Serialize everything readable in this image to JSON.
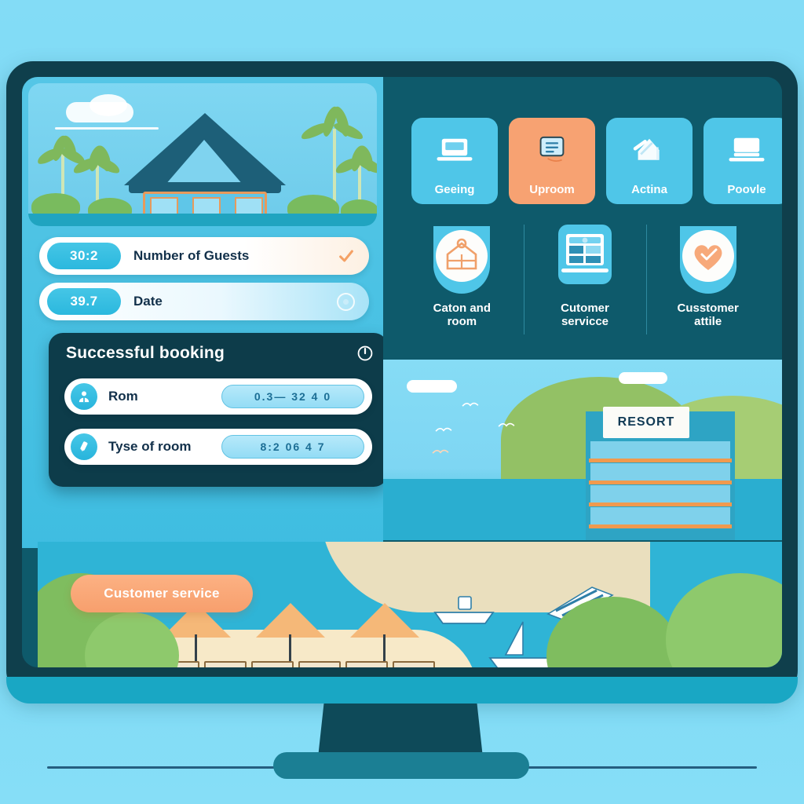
{
  "scene": {
    "device": "desktop-monitor",
    "background_color": "#7ddcf5",
    "bezel_color": "#0f3f4c",
    "screen_panel_color": "#0e5a6b"
  },
  "left_panel": {
    "hero_illustration": "tropical-resort-pavilion",
    "form_rows": [
      {
        "badge": "30:2",
        "label": "Number of Guests",
        "status_icon": "check-icon"
      },
      {
        "badge": "39.7",
        "label": "Date",
        "status_icon": "circle-icon"
      }
    ],
    "booking_card": {
      "title": "Successful booking",
      "header_icon": "power-icon",
      "rows": [
        {
          "icon": "person-icon",
          "label": "Rom",
          "value": "0.3— 32 4 0"
        },
        {
          "icon": "pen-icon",
          "label": "Tyse of room",
          "value": "8:2  06 4  7"
        }
      ]
    },
    "cta_button": {
      "label": "Customer service",
      "color": "#f79f6d"
    }
  },
  "right_panel": {
    "tiles": [
      {
        "label": "Geeing",
        "icon": "laptop-icon",
        "active": false
      },
      {
        "label": "Uproom",
        "icon": "document-screen-icon",
        "active": true
      },
      {
        "label": "Actina",
        "icon": "crane-icon",
        "active": false
      },
      {
        "label": "Poovle",
        "icon": "laptop-icon",
        "active": false
      }
    ],
    "features": [
      {
        "label_line1": "Caton and",
        "label_line2": "room",
        "icon": "building-badge-icon"
      },
      {
        "label_line1": "Cutomer",
        "label_line2": "servicce",
        "icon": "laptop-dashboard-icon"
      },
      {
        "label_line1": "Cusstomer",
        "label_line2": "attile",
        "icon": "heart-shield-icon"
      }
    ],
    "scenery": {
      "building_sign": "RESORT",
      "elements": [
        "sky",
        "clouds",
        "birds",
        "green-hills",
        "resort-building",
        "sea"
      ]
    }
  },
  "bottom_scene": {
    "elements": [
      "lagoon",
      "sand-beach",
      "beach-umbrellas",
      "loungers",
      "motorboat",
      "sailboat",
      "palm-foliage"
    ],
    "umbrella_count": 3
  }
}
